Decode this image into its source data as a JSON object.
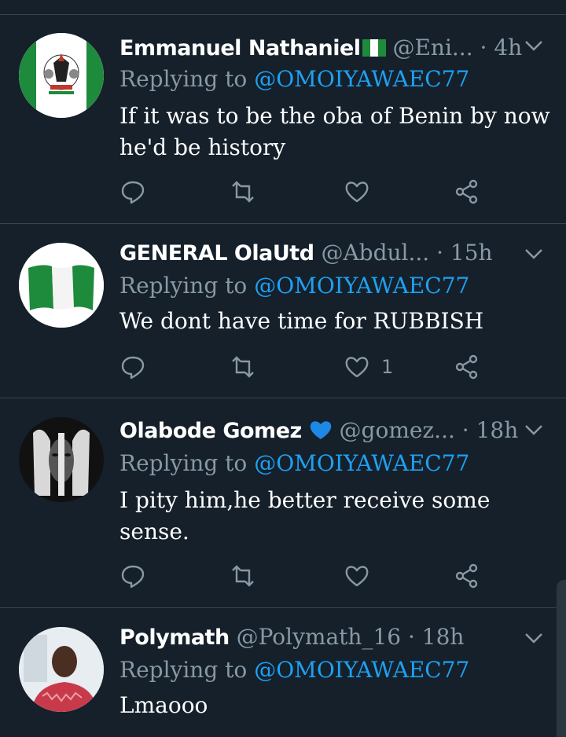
{
  "reply_prefix": "Replying to",
  "tweets": [
    {
      "name": "Emmanuel Nathaniel",
      "name_emoji": "nigeria-flag",
      "handle": "@Eni...",
      "time": "· 4h",
      "reply_to": "@OMOIYAWAEC77",
      "text": "If it was to be the oba of Benin by now he'd be history",
      "avatar": "nigeria-coat-of-arms",
      "like_count": ""
    },
    {
      "name": "GENERAL OlaUtd",
      "handle": "@Abdul...",
      "time": "· 15h",
      "reply_to": "@OMOIYAWAEC77",
      "text": "We dont have time for RUBBISH",
      "avatar": "nigeria-flag",
      "like_count": "1"
    },
    {
      "name": "Olabode Gomez",
      "name_emoji": "blue-heart",
      "handle": "@gomez...",
      "time": "· 18h",
      "reply_to": "@OMOIYAWAEC77",
      "text": "I pity him,he better receive some sense.",
      "avatar": "face-with-hands",
      "like_count": ""
    },
    {
      "name": "Polymath",
      "handle": "@Polymath_16",
      "time": "· 18h",
      "reply_to": "@OMOIYAWAEC77",
      "text": "Lmaooo",
      "avatar": "man-portrait",
      "like_count": ""
    }
  ],
  "colors": {
    "background": "#15202b",
    "muted": "#8899a6",
    "link": "#1da1f2",
    "divider": "#38444d"
  }
}
